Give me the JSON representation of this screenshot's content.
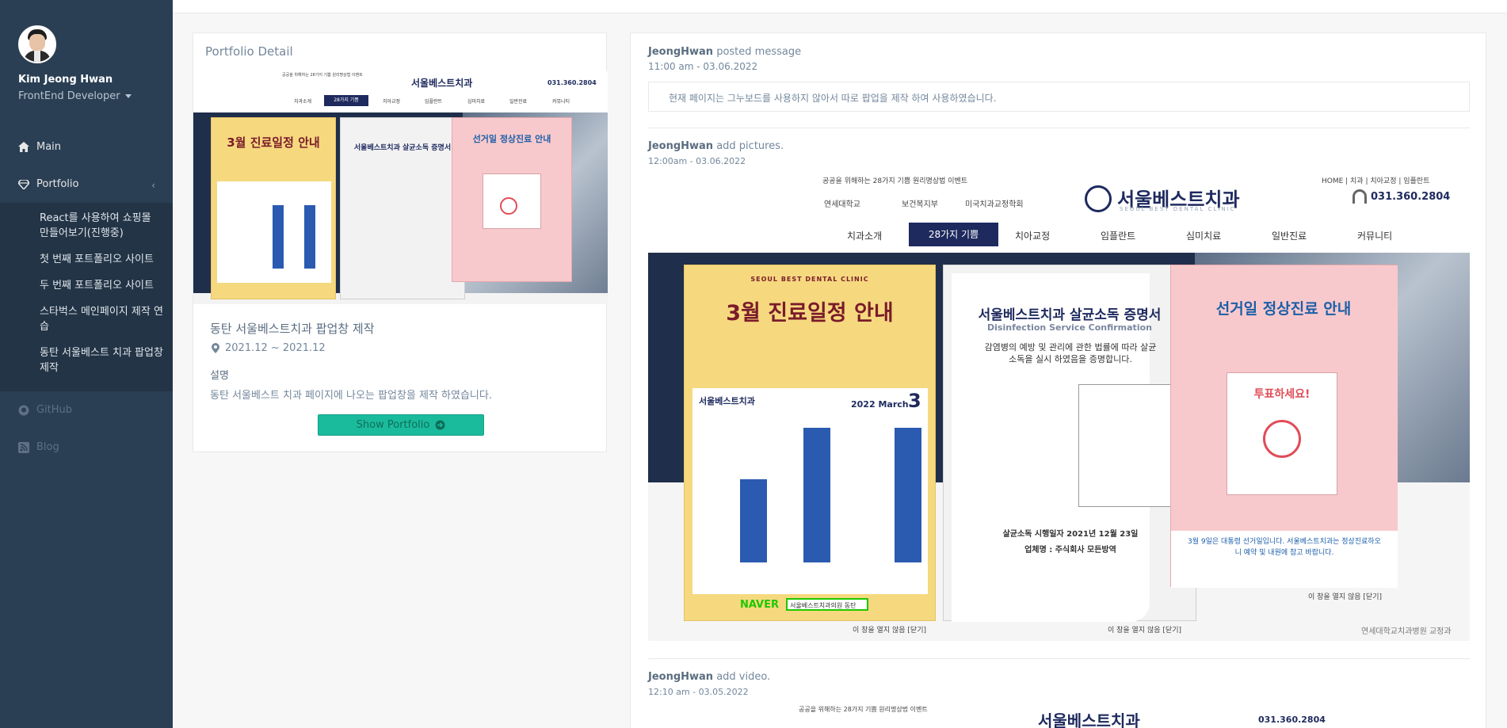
{
  "sidebar": {
    "profile": {
      "name": "Kim Jeong Hwan",
      "role": "FrontEnd Developer"
    },
    "menu": [
      {
        "label": "Main",
        "icon": "home-icon"
      },
      {
        "label": "Portfolio",
        "icon": "diamond-icon"
      }
    ],
    "submenu": [
      "React를 사용하여 쇼핑몰 만들어보기(진행중)",
      "첫 번째 포트폴리오 사이트",
      "두 번째 포트폴리오 사이트",
      "스타벅스 메인페이지 제작 연습",
      "동탄 서울베스트 치과 팝업창 제작"
    ],
    "menu_bottom": [
      {
        "label": "GitHub",
        "icon": "github-icon"
      },
      {
        "label": "Blog",
        "icon": "rss-icon"
      }
    ]
  },
  "detail": {
    "title": "Portfolio Detail",
    "project_title": "동탄 서울베스트치과 팝업창 제작",
    "date": "2021.12 ~ 2021.12",
    "desc_label": "설명",
    "desc_text": "동탄 서울베스트 치과 페이지에 나오는 팝업창을 제작 하였습니다.",
    "button_label": "Show Portfolio"
  },
  "feed": [
    {
      "author": "JeongHwan",
      "action": "posted message",
      "time": "11:00 am - 03.06.2022",
      "message": "현재 페이지는 그누보드를 사용하지 않아서 따로 팝업을 제작 하여 사용하였습니다."
    },
    {
      "author": "JeongHwan",
      "action": "add pictures.",
      "time": "12:00am - 03.06.2022"
    },
    {
      "author": "JeongHwan",
      "action": "add video.",
      "time": "12:10 am - 03.05.2022"
    }
  ],
  "site": {
    "logo": "서울베스트치과",
    "logo_sub": "SEOUL BEST DENTAL CLINIC",
    "phone": "031.360.2804",
    "top_links": "HOME | 치과 | 치아교정 | 임플란트",
    "top_left": "공공을 위해하는 28가지 기쁨   원리명상법   이벤트",
    "partners": [
      "연세대학교",
      "보건복지부",
      "미국치과교정학회"
    ],
    "nav": [
      "치과소개",
      "28가지 기쁨",
      "치아교정",
      "임플란트",
      "심미치료",
      "일반진료",
      "커뮤니티"
    ],
    "popup1_title": "3월 진료일정 안내",
    "popup1_tag": "SEOUL BEST DENTAL CLINIC",
    "popup1_month": "2022 March",
    "popup1_day": "3",
    "popup1_naver": "NAVER",
    "popup1_search": "서울베스트치과의원 동탄",
    "popup2_title": "서울베스트치과 살균소독 증명서",
    "popup2_sub": "Disinfection Service Confirmation",
    "popup2_body": "감염병의 예방 및 관리에 관한 법률에 따라 살균 소독을 실시 하였음을 증명합니다.",
    "popup2_date": "살균소독 시행일자 2021년 12월 23일",
    "popup2_company": "업체명 : 주식회사 모든방역",
    "popup3_title": "선거일 정상진료 안내",
    "popup3_ballot": "투표하세요!",
    "popup3_note": "3월 9일은 대통령 선거일입니다. 서울베스트치과는 정상진료하오니 예약 및 내원에 참고 바랍니다.",
    "close_text": "이 창을 열지 않음 [닫기]",
    "footer_note": "연세대학교치과병원 교정과"
  }
}
